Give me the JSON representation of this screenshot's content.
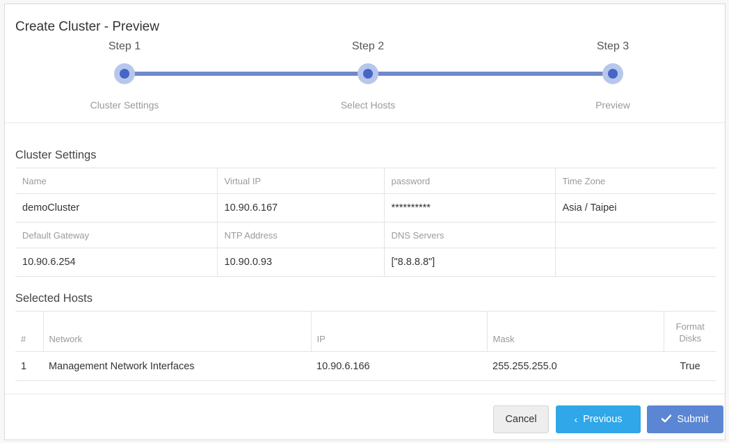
{
  "dialog": {
    "title": "Create Cluster - Preview"
  },
  "stepper": {
    "steps": [
      {
        "label": "Step 1",
        "sub": "Cluster Settings"
      },
      {
        "label": "Step 2",
        "sub": "Select Hosts"
      },
      {
        "label": "Step 3",
        "sub": "Preview"
      }
    ],
    "colors": {
      "line": "#6f89c9",
      "dot": "#4566c4",
      "halo": "#b7c7ec"
    }
  },
  "cluster_settings": {
    "title": "Cluster Settings",
    "row1_labels": [
      "Name",
      "Virtual IP",
      "password",
      "Time Zone"
    ],
    "row1_values": [
      "demoCluster",
      "10.90.6.167",
      "**********",
      "Asia / Taipei"
    ],
    "row2_labels": [
      "Default Gateway",
      "NTP Address",
      "DNS Servers"
    ],
    "row2_values": [
      "10.90.6.254",
      "10.90.0.93",
      "[\"8.8.8.8\"]"
    ]
  },
  "selected_hosts": {
    "title": "Selected Hosts",
    "columns": [
      "#",
      "Network",
      "IP",
      "Mask",
      "Format Disks"
    ],
    "rows": [
      [
        "1",
        "Management Network Interfaces",
        "10.90.6.166",
        "255.255.255.0",
        "True"
      ]
    ]
  },
  "buttons": {
    "cancel": "Cancel",
    "previous": "Previous",
    "submit": "Submit",
    "previous_icon": "chevron-left-icon",
    "submit_icon": "checkmark-icon",
    "colors": {
      "previous": "#2fa7e8",
      "submit": "#5b86d4"
    }
  }
}
